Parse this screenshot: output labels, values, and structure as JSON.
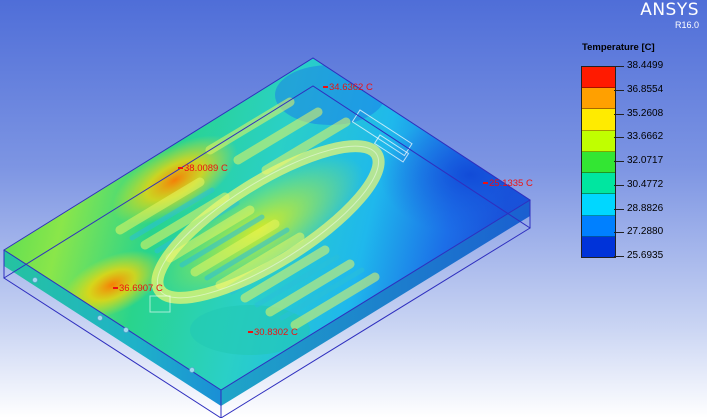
{
  "brand": {
    "name": "ANSYS",
    "version": "R16.0"
  },
  "legend": {
    "title": "Temperature [C]",
    "values": [
      "38.4499",
      "36.8554",
      "35.2608",
      "33.6662",
      "32.0717",
      "30.4772",
      "28.8826",
      "27.2880",
      "25.6935"
    ],
    "band_colors": [
      "#ff1a00",
      "#ffa000",
      "#ffeb00",
      "#c0ff00",
      "#33e633",
      "#00e6a0",
      "#00d7ff",
      "#0080ff",
      "#0033d9"
    ]
  },
  "probes": [
    {
      "label": "34.6362 C"
    },
    {
      "label": "38.0089 C"
    },
    {
      "label": "25.1335 C"
    },
    {
      "label": "36.6907 C"
    },
    {
      "label": "30.8302 C"
    }
  ]
}
